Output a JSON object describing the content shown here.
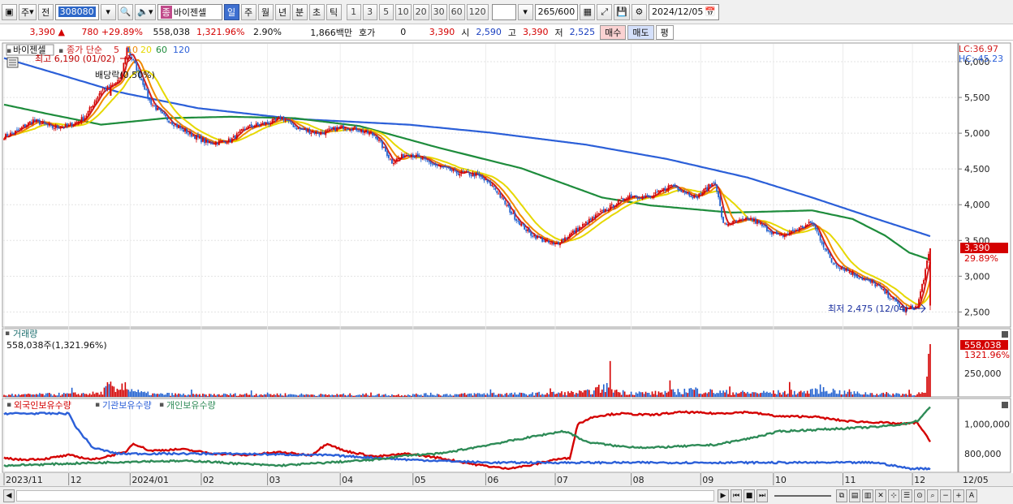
{
  "toolbar": {
    "market": "주",
    "prev_label": "전",
    "code": "308080",
    "name_badge": "종",
    "name": "바이젠셀",
    "period_tabs": [
      "일",
      "주",
      "월",
      "년",
      "분",
      "초",
      "틱"
    ],
    "active_period": "일",
    "interval_buttons": [
      "1",
      "3",
      "5",
      "10",
      "20",
      "30",
      "60",
      "120"
    ],
    "count": "265",
    "count_total": "/600",
    "date": "2024/12/05"
  },
  "quote": {
    "price": "3,390",
    "change": "780",
    "change_pct": "+29.89%",
    "volume": "558,038",
    "volume_pct": "1,321.96%",
    "turnover": "2.90%",
    "amount": "1,866백만",
    "hoga_label": "호가",
    "hoga": "0",
    "hoga_price": "3,390",
    "open_label": "시",
    "open": "2,590",
    "high_label": "고",
    "high": "3,390",
    "low_label": "저",
    "low": "2,525",
    "buy_label": "매수",
    "sell_label": "매도",
    "eval_label": "평"
  },
  "price_panel": {
    "legend_name": "바이젠셀",
    "legend_ma_label": "종가 단순",
    "ma_periods": [
      "5",
      "10",
      "20",
      "60",
      "120"
    ],
    "ma_colors": [
      "#d21e1e",
      "#f08a00",
      "#e6d800",
      "#1e8c3c",
      "#2b5fd8"
    ],
    "high_annotation": "최고 6,190 (01/02)",
    "dividend_annotation": "배당락(0.50%)",
    "low_annotation": "최저 2,475 (12/04)",
    "lc_label": "LC:36.97",
    "hc_label": "HC:-45.23",
    "y_ticks": [
      "6,000",
      "5,500",
      "5,000",
      "4,500",
      "4,000",
      "3,500",
      "3,000",
      "2,500"
    ],
    "current_price_tag": "3,390",
    "current_pct_tag": "29.89%"
  },
  "volume_panel": {
    "title": "거래량",
    "subtitle": "558,038주(1,321.96%)",
    "y_ticks": [
      "250,000"
    ],
    "current_tag": "558,038",
    "current_pct_tag": "1321.96%"
  },
  "holdings_panel": {
    "series": [
      {
        "name": "외국인보유수량",
        "color": "#d40000"
      },
      {
        "name": "기관보유수량",
        "color": "#2b5fd8"
      },
      {
        "name": "개인보유수량",
        "color": "#2e8b57"
      }
    ],
    "y_ticks": [
      "1,000,000",
      "800,000"
    ]
  },
  "x_axis": {
    "labels": [
      "2023/11",
      "12",
      "2024/01",
      "02",
      "03",
      "04",
      "05",
      "06",
      "07",
      "08",
      "09",
      "10",
      "11",
      "12"
    ],
    "right_date": "12/05"
  },
  "chart_data": {
    "type": "line",
    "title": "",
    "ylim": [
      2300,
      6250
    ],
    "anchors": {
      "close": [
        [
          0,
          4950
        ],
        [
          8,
          5030
        ],
        [
          18,
          5180
        ],
        [
          30,
          5080
        ],
        [
          40,
          5100
        ],
        [
          50,
          5220
        ],
        [
          60,
          5600
        ],
        [
          66,
          5650
        ],
        [
          72,
          5750
        ],
        [
          76,
          6190
        ],
        [
          80,
          6000
        ],
        [
          86,
          5700
        ],
        [
          90,
          5450
        ],
        [
          98,
          5250
        ],
        [
          110,
          5050
        ],
        [
          126,
          4860
        ],
        [
          140,
          4900
        ],
        [
          150,
          5080
        ],
        [
          165,
          5150
        ],
        [
          172,
          5220
        ],
        [
          182,
          5060
        ],
        [
          195,
          5000
        ],
        [
          210,
          5090
        ],
        [
          218,
          5060
        ],
        [
          230,
          4960
        ],
        [
          240,
          4600
        ],
        [
          250,
          4720
        ],
        [
          268,
          4540
        ],
        [
          280,
          4450
        ],
        [
          292,
          4420
        ],
        [
          303,
          4250
        ],
        [
          315,
          3850
        ],
        [
          325,
          3600
        ],
        [
          340,
          3430
        ],
        [
          353,
          3630
        ],
        [
          370,
          3900
        ],
        [
          387,
          4130
        ],
        [
          400,
          4100
        ],
        [
          413,
          4280
        ],
        [
          428,
          4100
        ],
        [
          440,
          4330
        ],
        [
          445,
          3720
        ],
        [
          462,
          3800
        ],
        [
          480,
          3550
        ],
        [
          500,
          3750
        ],
        [
          512,
          3200
        ],
        [
          528,
          3000
        ],
        [
          540,
          2870
        ],
        [
          557,
          2530
        ],
        [
          565,
          2570
        ],
        [
          573,
          3390
        ]
      ],
      "ma120": [
        [
          0,
          6050
        ],
        [
          30,
          5850
        ],
        [
          70,
          5580
        ],
        [
          120,
          5350
        ],
        [
          180,
          5200
        ],
        [
          250,
          5120
        ],
        [
          300,
          5010
        ],
        [
          360,
          4840
        ],
        [
          410,
          4640
        ],
        [
          460,
          4380
        ],
        [
          500,
          4100
        ],
        [
          540,
          3800
        ],
        [
          573,
          3560
        ]
      ],
      "ma60": [
        [
          0,
          5400
        ],
        [
          25,
          5280
        ],
        [
          60,
          5120
        ],
        [
          100,
          5210
        ],
        [
          140,
          5230
        ],
        [
          180,
          5210
        ],
        [
          220,
          5100
        ],
        [
          270,
          4790
        ],
        [
          320,
          4510
        ],
        [
          370,
          4100
        ],
        [
          400,
          3990
        ],
        [
          450,
          3890
        ],
        [
          500,
          3920
        ],
        [
          525,
          3800
        ],
        [
          545,
          3570
        ],
        [
          560,
          3330
        ],
        [
          573,
          3230
        ]
      ]
    },
    "volume_values": [
      [
        0,
        4
      ],
      [
        10,
        5
      ],
      [
        20,
        6
      ],
      [
        40,
        7
      ],
      [
        60,
        9
      ],
      [
        65,
        28
      ],
      [
        70,
        13
      ],
      [
        75,
        40
      ],
      [
        78,
        11
      ],
      [
        80,
        16
      ],
      [
        85,
        10
      ],
      [
        90,
        8
      ],
      [
        95,
        6
      ],
      [
        100,
        7
      ],
      [
        120,
        5
      ],
      [
        140,
        6
      ],
      [
        160,
        7
      ],
      [
        180,
        6
      ],
      [
        200,
        5
      ],
      [
        220,
        6
      ],
      [
        240,
        5
      ],
      [
        260,
        6
      ],
      [
        280,
        6
      ],
      [
        300,
        8
      ],
      [
        320,
        7
      ],
      [
        340,
        9
      ],
      [
        360,
        11
      ],
      [
        375,
        27
      ],
      [
        380,
        12
      ],
      [
        400,
        9
      ],
      [
        420,
        14
      ],
      [
        425,
        18
      ],
      [
        440,
        12
      ],
      [
        460,
        10
      ],
      [
        480,
        11
      ],
      [
        500,
        13
      ],
      [
        505,
        20
      ],
      [
        520,
        10
      ],
      [
        540,
        8
      ],
      [
        560,
        7
      ],
      [
        570,
        9
      ],
      [
        573,
        100
      ]
    ],
    "holdings_series": {
      "외국인보유수량": [
        [
          0,
          770
        ],
        [
          10,
          760
        ],
        [
          25,
          765
        ],
        [
          40,
          790
        ],
        [
          55,
          760
        ],
        [
          75,
          810
        ],
        [
          80,
          870
        ],
        [
          90,
          820
        ],
        [
          110,
          830
        ],
        [
          130,
          800
        ],
        [
          150,
          790
        ],
        [
          170,
          810
        ],
        [
          190,
          790
        ],
        [
          200,
          870
        ],
        [
          210,
          820
        ],
        [
          230,
          780
        ],
        [
          250,
          800
        ],
        [
          270,
          770
        ],
        [
          290,
          730
        ],
        [
          310,
          700
        ],
        [
          325,
          720
        ],
        [
          340,
          760
        ],
        [
          350,
          770
        ],
        [
          355,
          1000
        ],
        [
          365,
          1050
        ],
        [
          380,
          1070
        ],
        [
          400,
          1060
        ],
        [
          420,
          1080
        ],
        [
          440,
          1070
        ],
        [
          460,
          1080
        ],
        [
          480,
          1050
        ],
        [
          500,
          1050
        ],
        [
          520,
          1020
        ],
        [
          540,
          1010
        ],
        [
          557,
          1000
        ],
        [
          565,
          1010
        ],
        [
          573,
          880
        ]
      ],
      "기관보유수량": [
        [
          0,
          1070
        ],
        [
          40,
          1070
        ],
        [
          45,
          970
        ],
        [
          55,
          840
        ],
        [
          70,
          800
        ],
        [
          100,
          800
        ],
        [
          140,
          800
        ],
        [
          200,
          790
        ],
        [
          250,
          760
        ],
        [
          300,
          740
        ],
        [
          380,
          740
        ],
        [
          450,
          740
        ],
        [
          500,
          740
        ],
        [
          540,
          740
        ],
        [
          560,
          700
        ],
        [
          573,
          700
        ]
      ],
      "개인보유수량": [
        [
          0,
          720
        ],
        [
          30,
          730
        ],
        [
          60,
          740
        ],
        [
          90,
          750
        ],
        [
          120,
          750
        ],
        [
          150,
          730
        ],
        [
          170,
          720
        ],
        [
          200,
          740
        ],
        [
          230,
          760
        ],
        [
          250,
          790
        ],
        [
          270,
          800
        ],
        [
          290,
          840
        ],
        [
          310,
          880
        ],
        [
          330,
          920
        ],
        [
          345,
          950
        ],
        [
          350,
          940
        ],
        [
          360,
          880
        ],
        [
          380,
          850
        ],
        [
          400,
          840
        ],
        [
          420,
          850
        ],
        [
          440,
          860
        ],
        [
          460,
          900
        ],
        [
          480,
          950
        ],
        [
          500,
          960
        ],
        [
          520,
          970
        ],
        [
          540,
          980
        ],
        [
          557,
          1000
        ],
        [
          565,
          1020
        ],
        [
          573,
          1110
        ]
      ]
    },
    "holdings_ylim": [
      680,
      1160
    ]
  }
}
